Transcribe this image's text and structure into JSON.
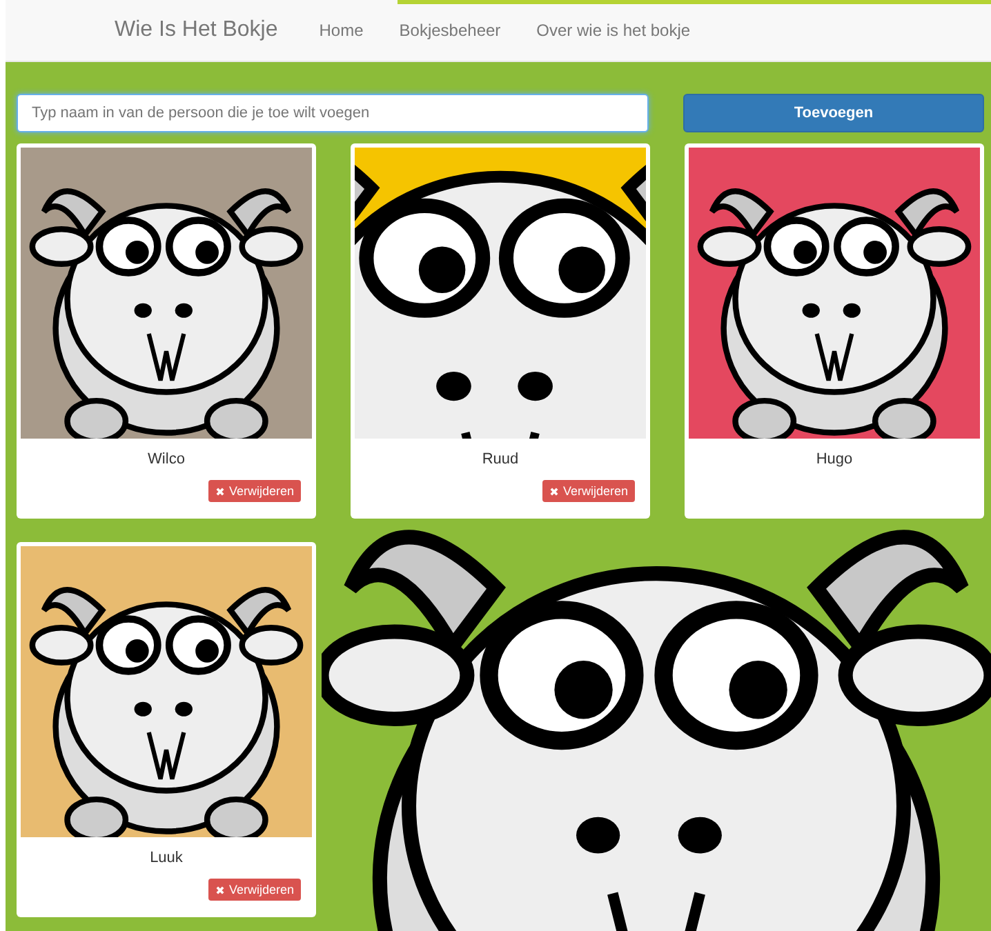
{
  "navbar": {
    "brand": "Wie Is Het Bokje",
    "links": [
      "Home",
      "Bokjesbeheer",
      "Over wie is het bokje"
    ]
  },
  "add_form": {
    "placeholder": "Typ naam in van de persoon die je toe wilt voegen",
    "button": "Toevoegen"
  },
  "cards": [
    {
      "name": "Wilco",
      "color": "#a89a8a",
      "kind": "full",
      "delete_button": "Verwijderen"
    },
    {
      "name": "Ruud",
      "color": "#f5c400",
      "kind": "closeup",
      "delete_button": "Verwijderen"
    },
    {
      "name": "Hugo",
      "color": "#e4485f",
      "kind": "full"
    },
    {
      "name": "Luuk",
      "color": "#e8bb70",
      "kind": "full",
      "delete_button": "Verwijderen"
    }
  ]
}
